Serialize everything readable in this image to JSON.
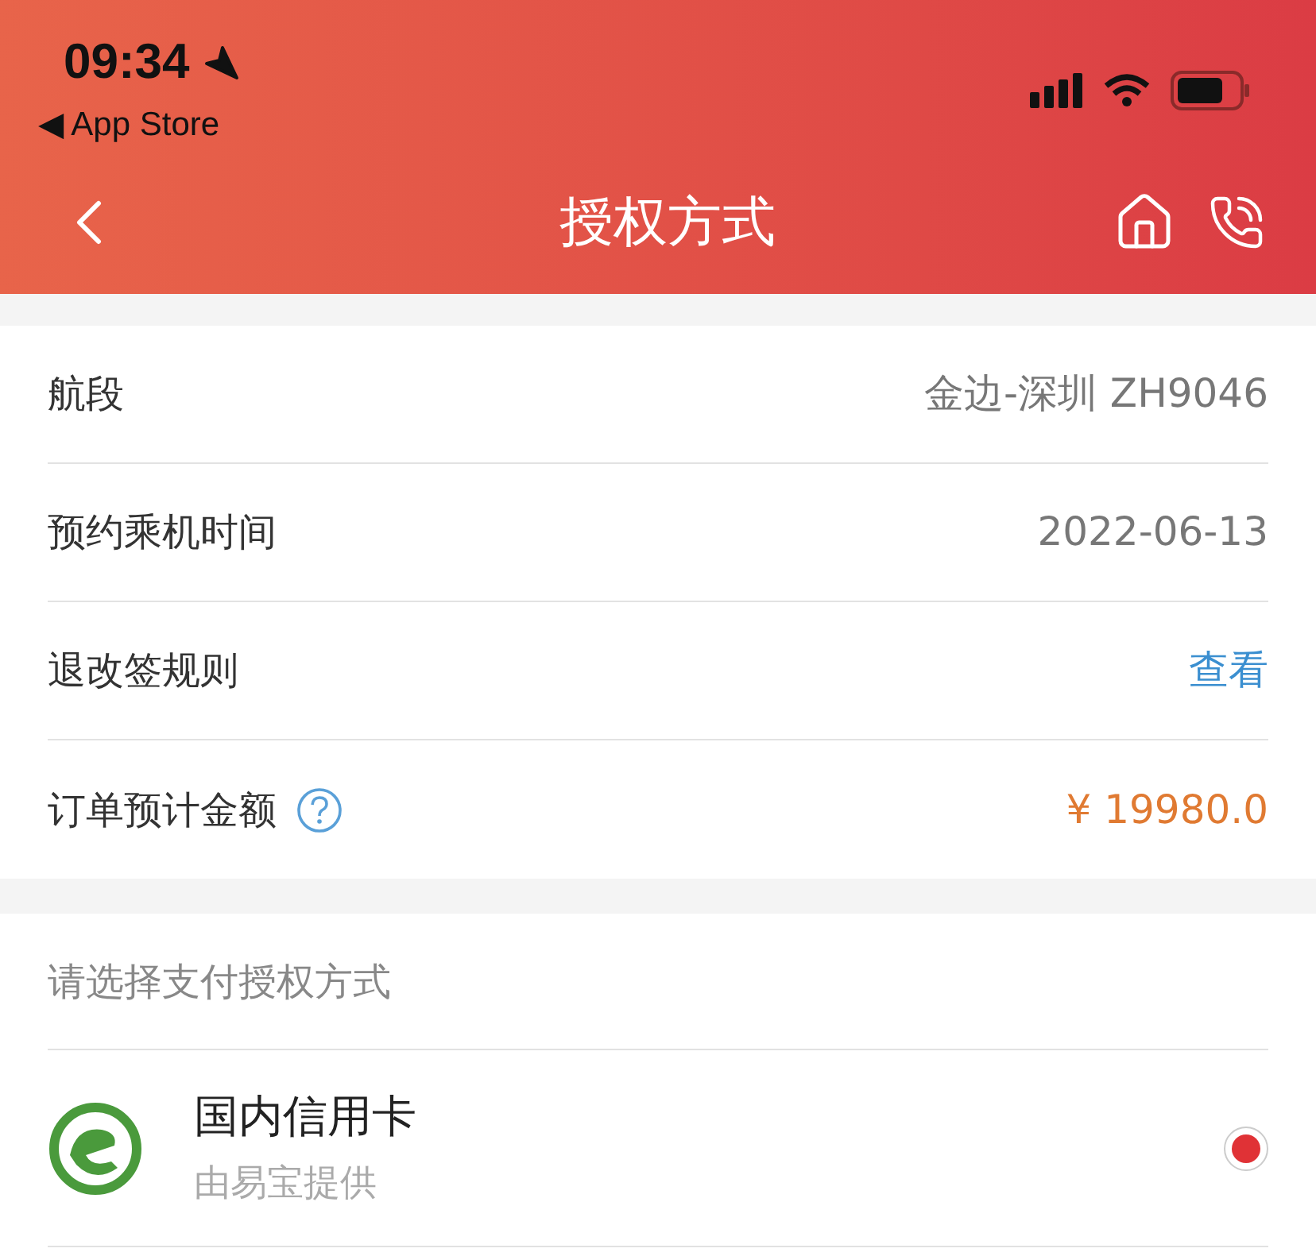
{
  "status_bar": {
    "time": "09:34",
    "back_label": "◀ App Store"
  },
  "nav": {
    "title": "授权方式"
  },
  "info_rows": [
    {
      "label": "航段",
      "value": "金边-深圳 ZH9046",
      "kind": "text",
      "help": false
    },
    {
      "label": "预约乘机时间",
      "value": "2022-06-13",
      "kind": "text",
      "help": false
    },
    {
      "label": "退改签规则",
      "value": "查看",
      "kind": "link",
      "help": false
    },
    {
      "label": "订单预计金额",
      "value": "¥ 19980.0",
      "kind": "amount",
      "help": true
    }
  ],
  "payment": {
    "heading": "请选择支付授权方式",
    "options": [
      {
        "name": "国内信用卡",
        "provider": "由易宝提供",
        "selected": true
      }
    ]
  }
}
